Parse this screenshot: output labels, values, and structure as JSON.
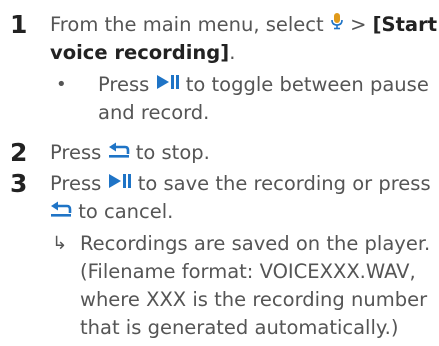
{
  "steps": [
    {
      "number": "1",
      "line1_before": "From the main menu, select",
      "line1_after": ">",
      "menu_item_line1": "[Start",
      "menu_item_line2": "voice recording]",
      "line2_end": ".",
      "icon": "microphone-icon",
      "bullet": {
        "symbol": "•",
        "prefix": "Press",
        "icon": "play-pause-icon",
        "line1_rest": "to toggle between pause",
        "line2": "and record."
      }
    },
    {
      "number": "2",
      "prefix": "Press",
      "icon": "back-icon",
      "rest": "to stop."
    },
    {
      "number": "3",
      "prefix": "Press",
      "icon_1": "play-pause-icon",
      "line1_rest": "to save the recording or press",
      "icon_2": "back-icon",
      "line2_rest": "to cancel.",
      "result": {
        "symbol": "↳",
        "lines": [
          "Recordings are saved on the player.",
          "(Filename format: VOICEXXX.WAV,",
          "where XXX is the recording number",
          "that is generated automatically.)"
        ]
      }
    }
  ],
  "colors": {
    "text": "#555555",
    "emphasis": "#222222",
    "icon_blue": "#1f74c6",
    "icon_orange": "#e09a1a"
  }
}
